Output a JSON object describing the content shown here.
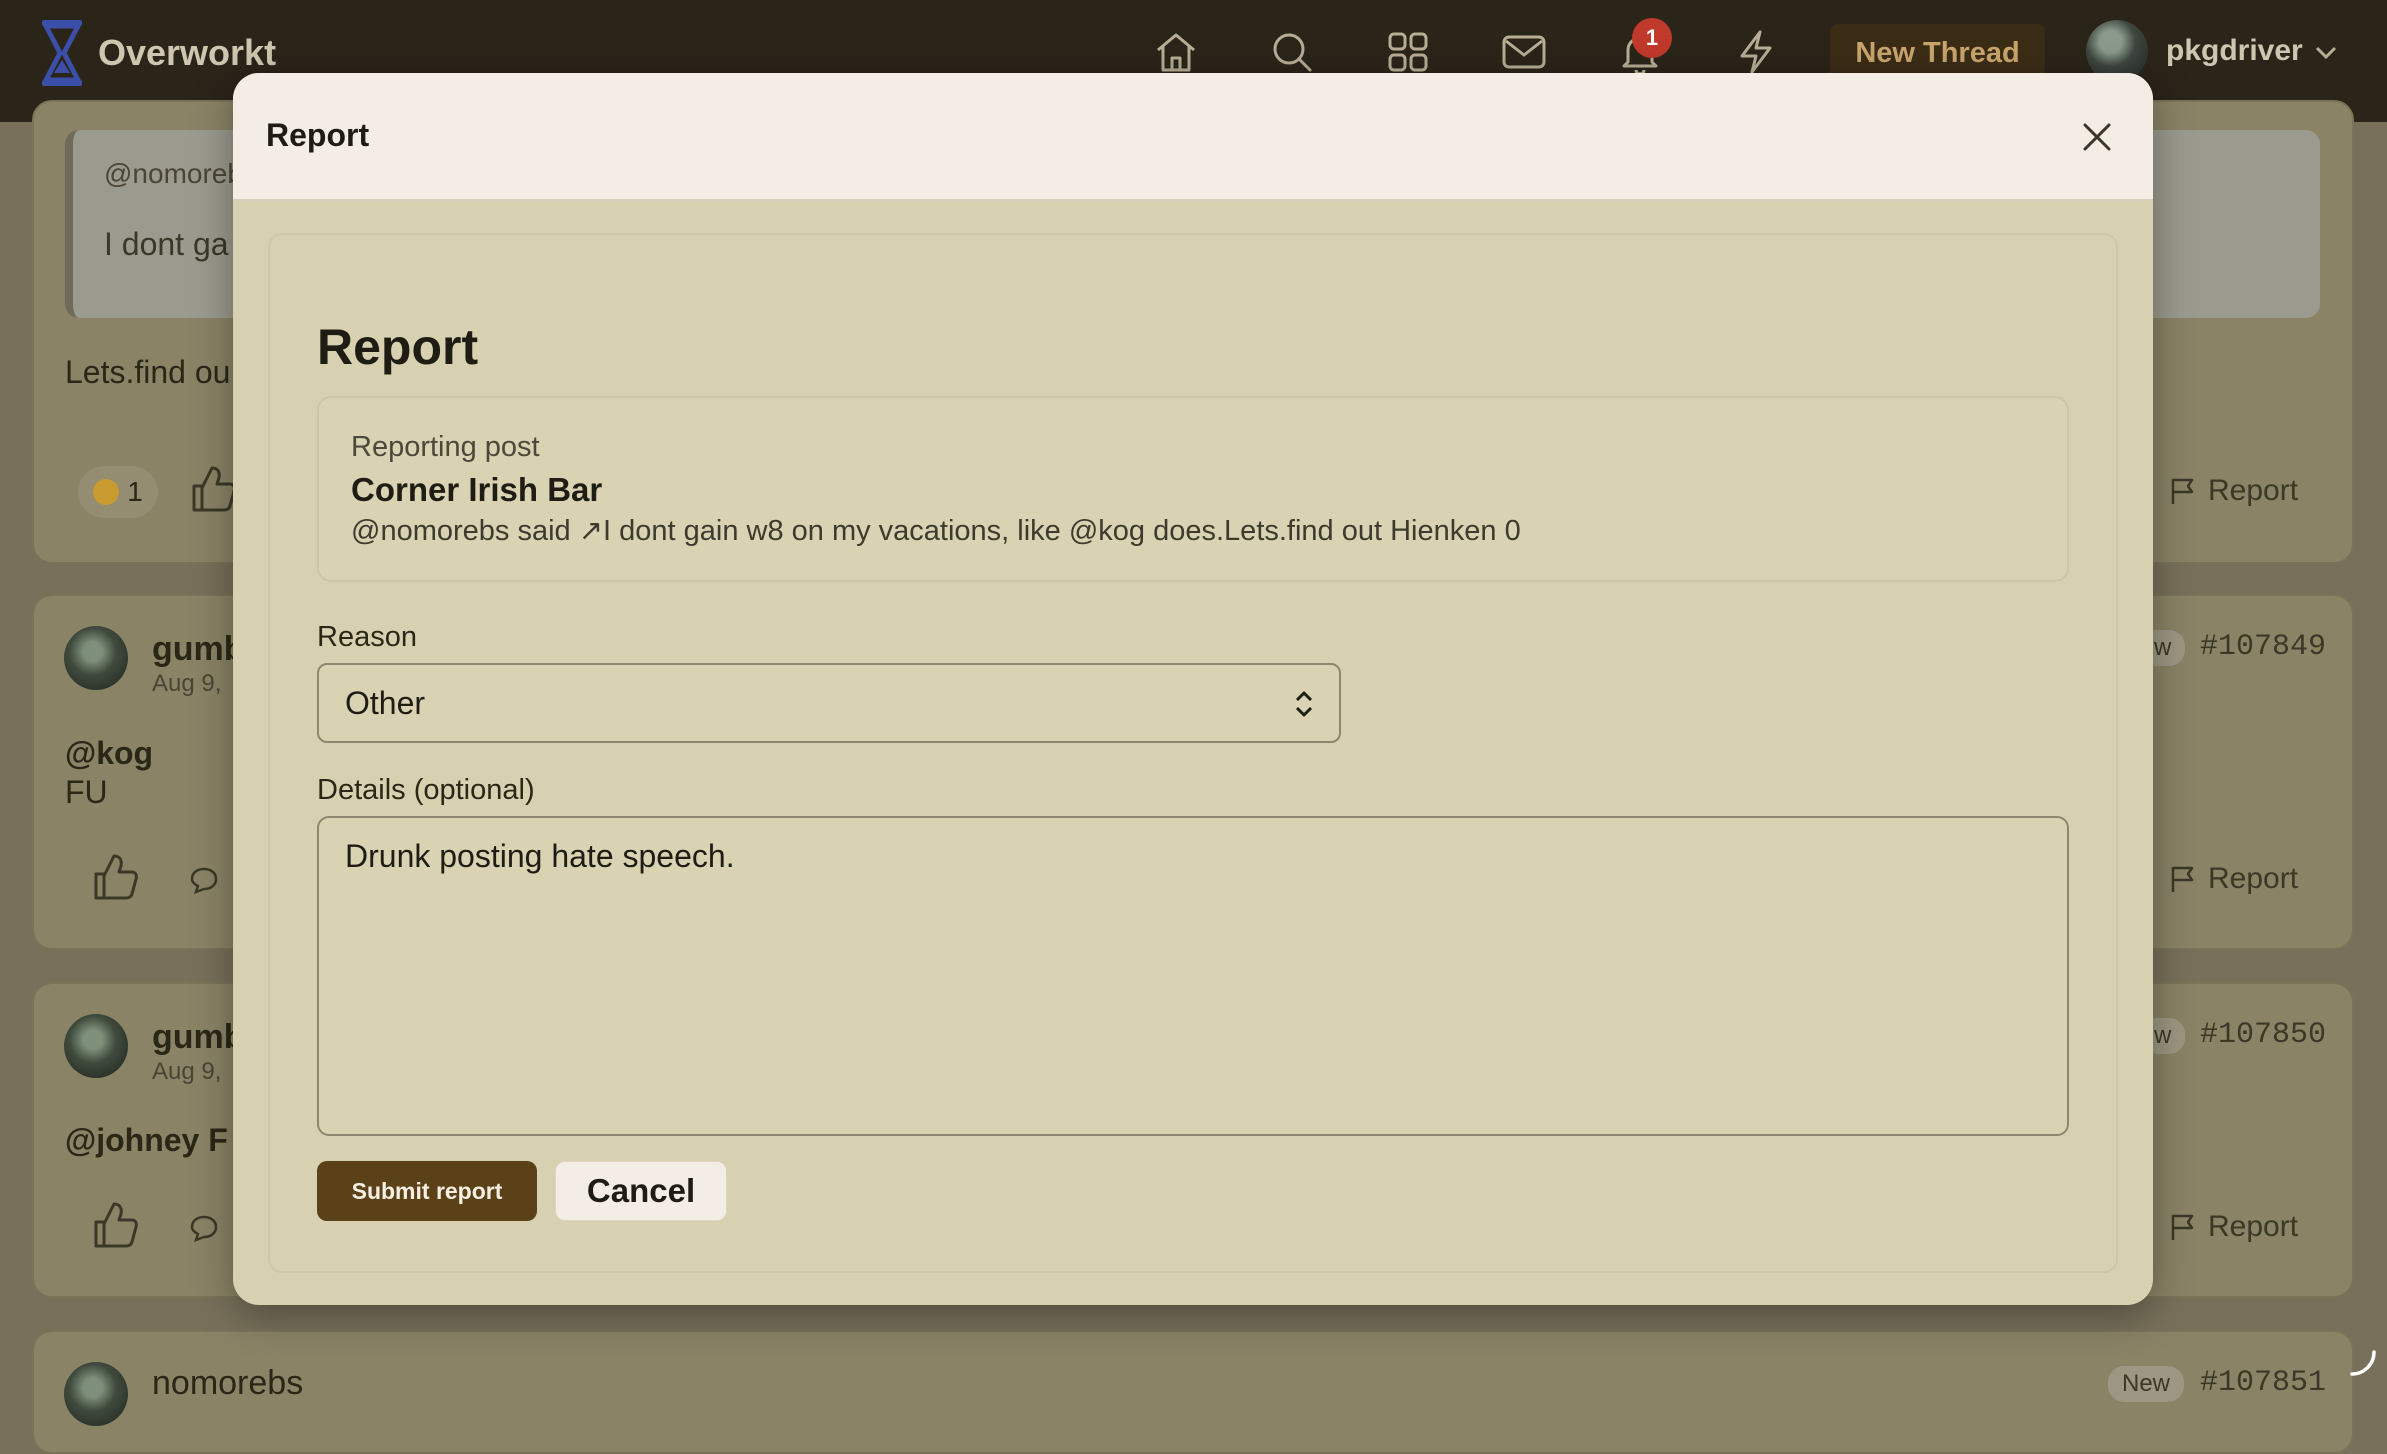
{
  "app": {
    "name": "Overworkt"
  },
  "nav": {
    "notifications_count": "1",
    "new_thread_label": "New Thread",
    "username": "pkgdriver",
    "icons": [
      "home-icon",
      "search-icon",
      "grid-icon",
      "mail-icon",
      "bell-icon",
      "bolt-icon"
    ]
  },
  "feed": {
    "post1": {
      "quote_author": "@nomoreb",
      "quote_text": "I dont ga",
      "body": "Lets.find ou",
      "reaction_count": "1",
      "report_label": "Report"
    },
    "post2": {
      "author": "gumb",
      "date": "Aug 9,",
      "badge": "w",
      "id": "#107849",
      "body_line1": "@kog",
      "body_line2": "FU",
      "report_label": "Report"
    },
    "post3": {
      "author": "gumb",
      "date": "Aug 9,",
      "badge": "w",
      "id": "#107850",
      "body": "@johney F",
      "report_label": "Report"
    },
    "post4": {
      "author": "nomorebs",
      "badge": "New",
      "id": "#107851"
    }
  },
  "modal": {
    "title": "Report",
    "heading": "Report",
    "post_kicker": "Reporting post",
    "post_title": "Corner Irish Bar",
    "post_excerpt": "@nomorebs said ↗I dont gain w8 on my vacations, like @kog does.Lets.find out Hienken 0",
    "reason_label": "Reason",
    "reason_value": "Other",
    "details_label": "Details (optional)",
    "details_value": "Drunk posting hate speech.",
    "submit_label": "Submit report",
    "cancel_label": "Cancel"
  },
  "colors": {
    "topbar": "#2a2419",
    "modal_bg": "#d8d1b1",
    "modal_header": "#f3ede5",
    "primary_button": "#5b4117",
    "notification_badge": "#c0392b"
  }
}
